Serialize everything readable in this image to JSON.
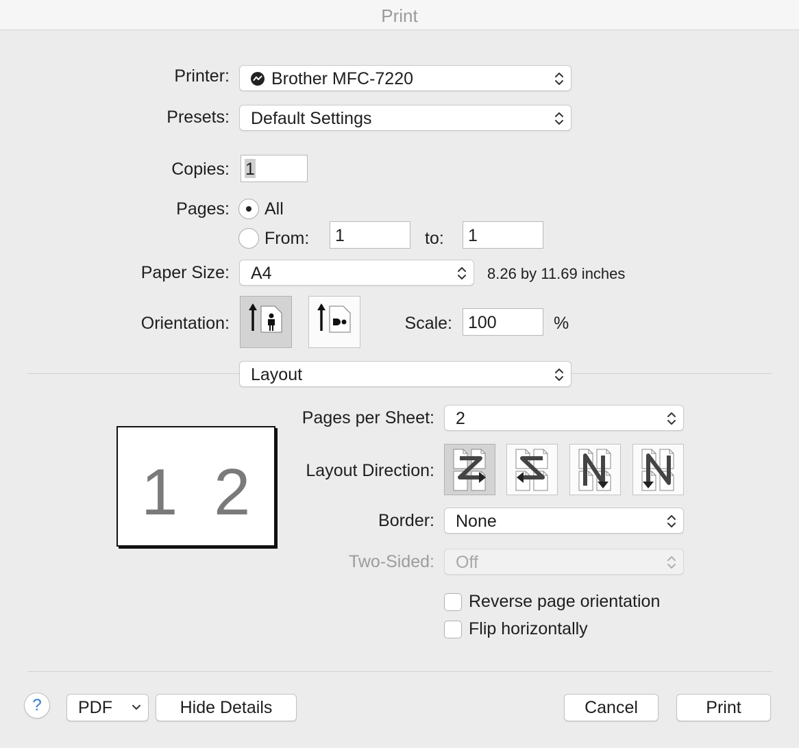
{
  "window": {
    "title": "Print"
  },
  "printer": {
    "label": "Printer:",
    "value": "Brother MFC-7220"
  },
  "presets": {
    "label": "Presets:",
    "value": "Default Settings"
  },
  "copies": {
    "label": "Copies:",
    "value": "1"
  },
  "pages": {
    "label": "Pages:",
    "all_label": "All",
    "from_label": "From:",
    "from_value": "1",
    "to_label": "to:",
    "to_value": "1",
    "selected": "All"
  },
  "paper_size": {
    "label": "Paper Size:",
    "value": "A4",
    "dimensions": "8.26 by 11.69 inches"
  },
  "orientation": {
    "label": "Orientation:",
    "selected": "portrait"
  },
  "scale": {
    "label": "Scale:",
    "value": "100",
    "unit": "%"
  },
  "section": {
    "value": "Layout"
  },
  "layout": {
    "preview_pages": [
      "1",
      "2"
    ],
    "pages_per_sheet": {
      "label": "Pages per Sheet:",
      "value": "2"
    },
    "layout_direction": {
      "label": "Layout Direction:",
      "selected_index": 0,
      "icons": [
        "z-direction-icon",
        "reverse-z-direction-icon",
        "n-reverse-direction-icon",
        "n-direction-icon"
      ]
    },
    "border": {
      "label": "Border:",
      "value": "None"
    },
    "two_sided": {
      "label": "Two-Sided:",
      "value": "Off",
      "enabled": false
    },
    "reverse_orientation": {
      "label": "Reverse page orientation",
      "checked": false
    },
    "flip_horizontally": {
      "label": "Flip horizontally",
      "checked": false
    }
  },
  "footer": {
    "help_label": "?",
    "pdf_label": "PDF",
    "hide_details_label": "Hide Details",
    "cancel_label": "Cancel",
    "print_label": "Print"
  }
}
